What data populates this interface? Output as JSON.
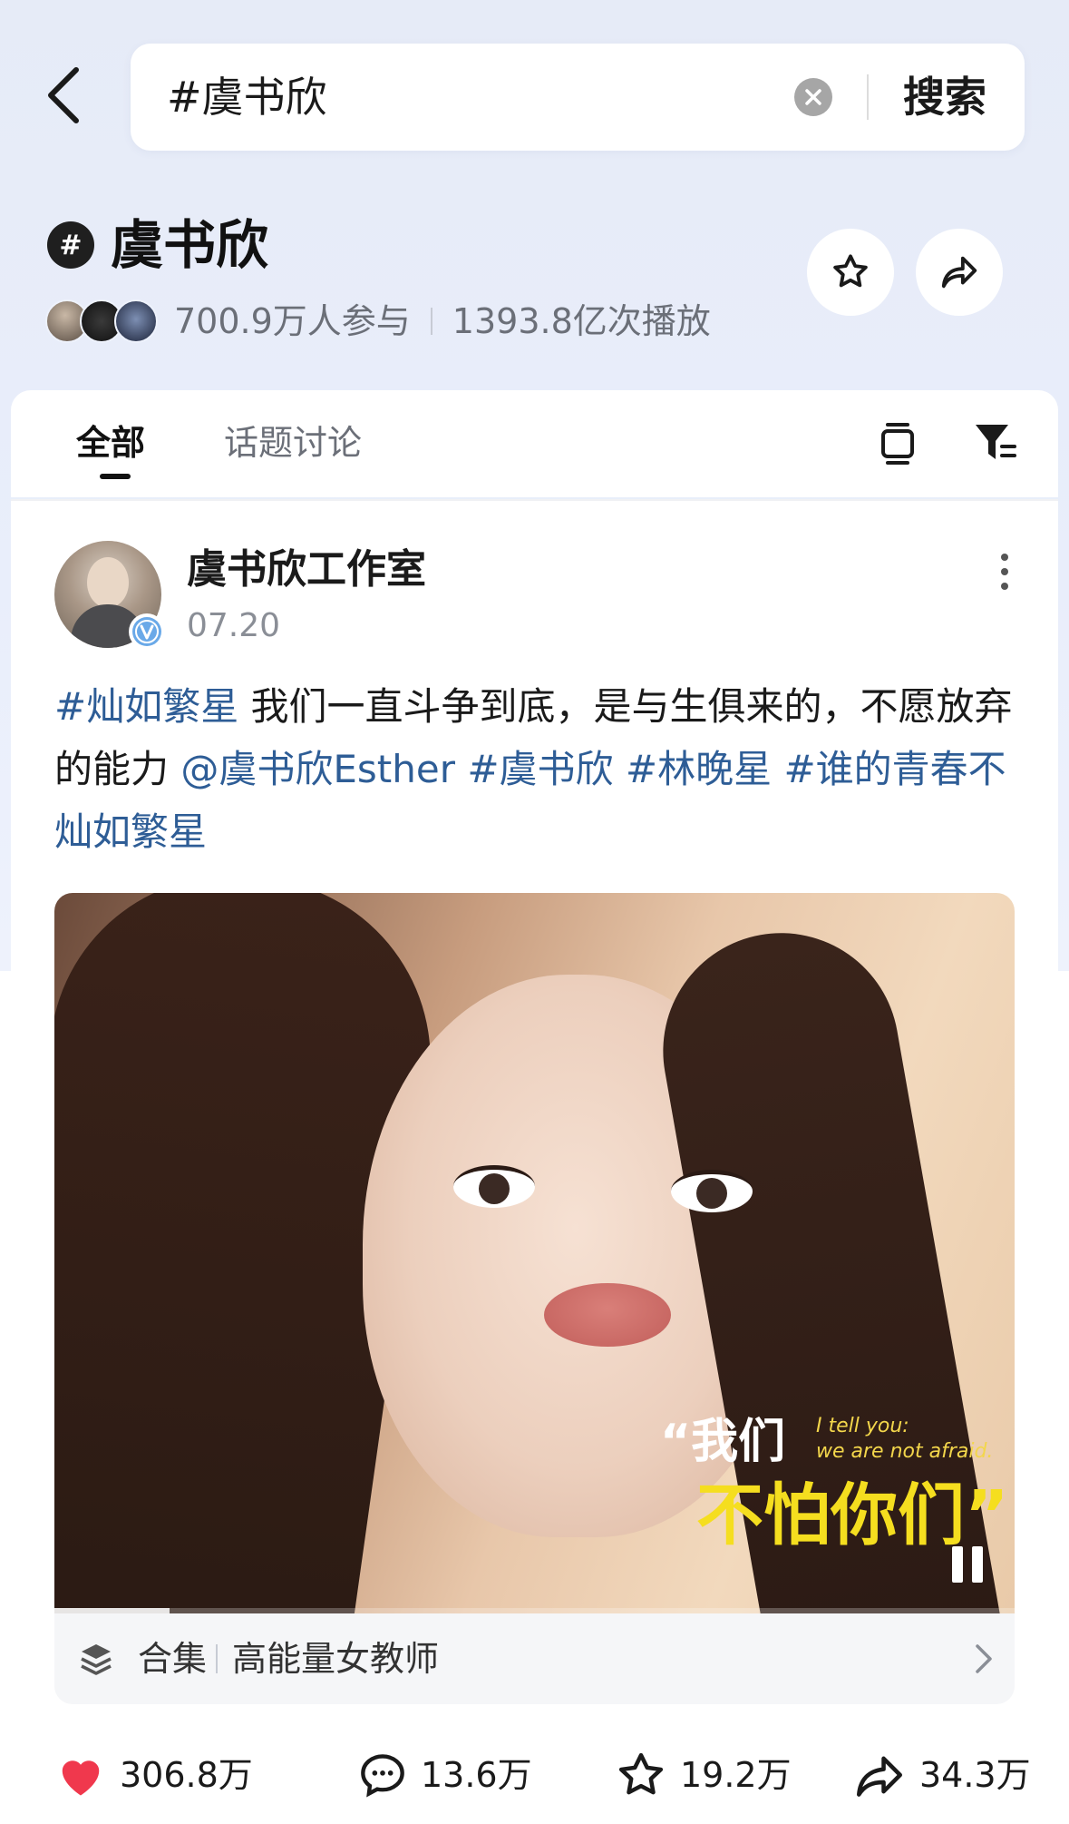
{
  "search": {
    "query": "#虞书欣",
    "button_label": "搜索"
  },
  "topic": {
    "hash_symbol": "#",
    "title": "虞书欣",
    "participants": "700.9万人参与",
    "plays": "1393.8亿次播放"
  },
  "tabs": [
    {
      "label": "全部",
      "active": true
    },
    {
      "label": "话题讨论",
      "active": false
    }
  ],
  "post": {
    "author": "虞书欣工作室",
    "date": "07.20",
    "text_segments": [
      {
        "text": "#灿如繁星",
        "type": "tag"
      },
      {
        "text": " 我们一直斗争到底，是与生俱来的，不愿放弃的能力 ",
        "type": "text"
      },
      {
        "text": "@虞书欣Esther",
        "type": "tag"
      },
      {
        "text": " ",
        "type": "text"
      },
      {
        "text": "#虞书欣",
        "type": "tag"
      },
      {
        "text": " ",
        "type": "text"
      },
      {
        "text": "#林晚星",
        "type": "tag"
      },
      {
        "text": " ",
        "type": "text"
      },
      {
        "text": "#谁的青春不灿如繁星",
        "type": "tag"
      }
    ],
    "video": {
      "caption_line1": "“我们",
      "caption_en_line1": "I tell you:",
      "caption_en_line2": "we are not afraid.",
      "caption_line2": "不怕你们”",
      "progress": 0.12
    },
    "collection": {
      "label": "合集",
      "title": "高能量女教师"
    },
    "actions": {
      "likes": "306.8万",
      "comments": "13.6万",
      "favorites": "19.2万",
      "shares": "34.3万"
    }
  },
  "colors": {
    "accent_tag": "#2e5d96",
    "like_heart": "#f0384d",
    "caption_yellow": "#f5de1f"
  },
  "icons": [
    "back-arrow-icon",
    "clear-icon",
    "star-icon",
    "share-icon",
    "layers-icon",
    "filter-icon",
    "verified-icon",
    "more-icon",
    "pause-icon",
    "collection-stack-icon",
    "chevron-right-icon",
    "heart-icon",
    "comment-icon",
    "favorite-icon",
    "forward-icon"
  ]
}
